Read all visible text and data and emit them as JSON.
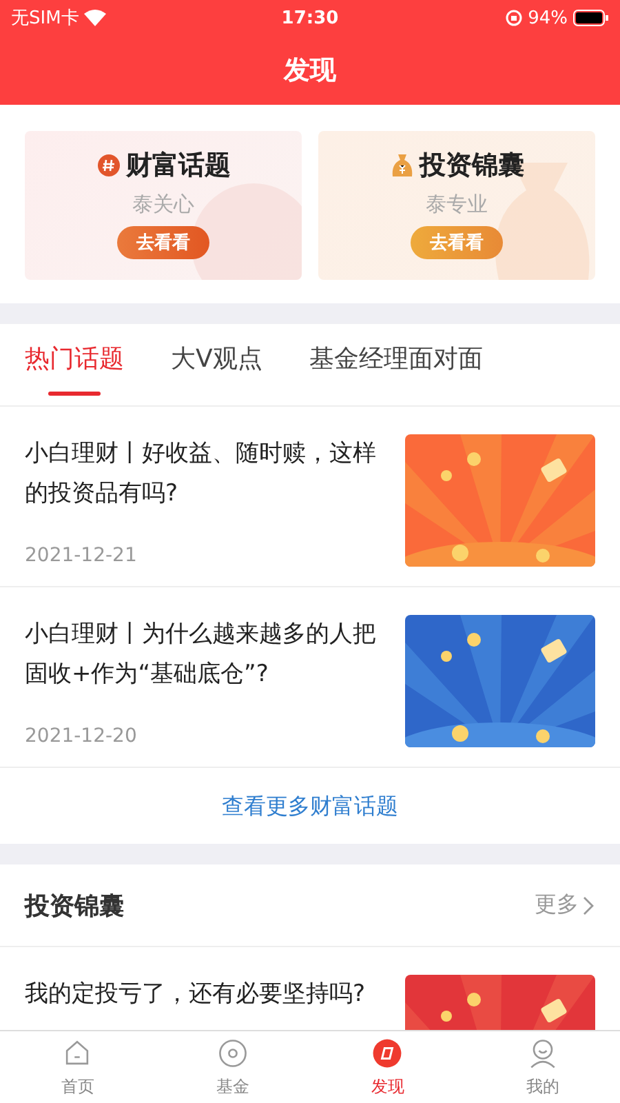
{
  "status_bar": {
    "carrier": "无SIM卡",
    "time": "17:30",
    "battery": "94%"
  },
  "header": {
    "title": "发现"
  },
  "promo_cards": [
    {
      "kind": "topic",
      "title": "财富话题",
      "subtitle": "泰关心",
      "button": "去看看"
    },
    {
      "kind": "bag",
      "title": "投资锦囊",
      "subtitle": "泰专业",
      "button": "去看看"
    }
  ],
  "tabs": [
    {
      "label": "热门话题",
      "selected": true
    },
    {
      "label": "大V观点",
      "selected": false
    },
    {
      "label": "基金经理面对面",
      "selected": false
    }
  ],
  "articles": [
    {
      "title": "小白理财丨好收益、随时赎，这样的投资品有吗?",
      "date": "2021-12-21"
    },
    {
      "title": "小白理财丨为什么越来越多的人把固收+作为“基础底仓”?",
      "date": "2021-12-20"
    }
  ],
  "more_link": "查看更多财富话题",
  "section": {
    "title": "投资锦囊",
    "more": "更多"
  },
  "section_articles": [
    {
      "title": "我的定投亏了，还有必要坚持吗?"
    }
  ],
  "tab_bar": [
    {
      "label": "首页",
      "selected": false
    },
    {
      "label": "基金",
      "selected": false
    },
    {
      "label": "发现",
      "selected": true
    },
    {
      "label": "我的",
      "selected": false
    }
  ]
}
